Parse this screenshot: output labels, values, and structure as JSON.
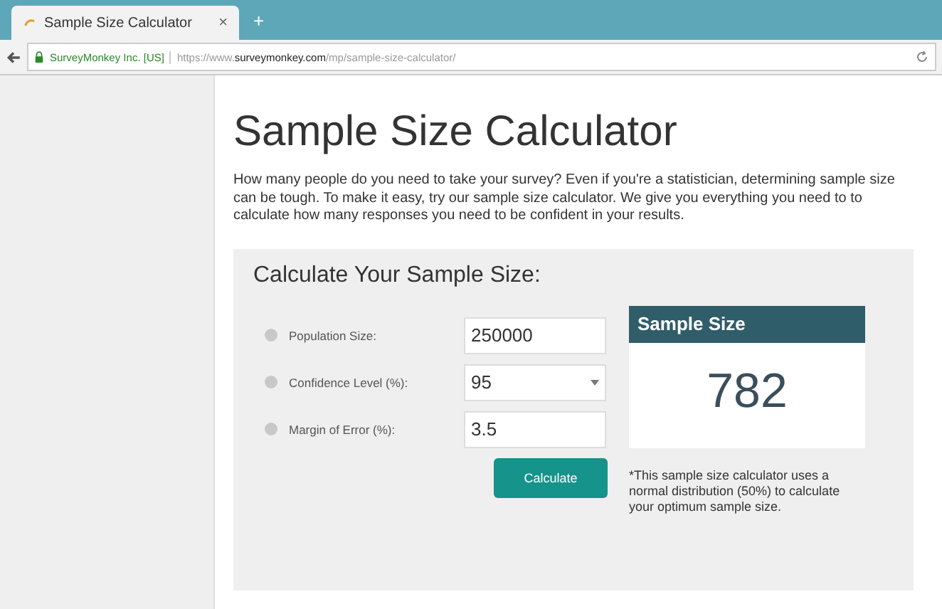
{
  "browser": {
    "tab": {
      "title": "Sample Size Calculator",
      "close": "×"
    },
    "new_tab": "+",
    "security": "SurveyMonkey Inc. [US]",
    "url_scheme": "https://www.",
    "url_domain": "surveymonkey.com",
    "url_path": "/mp/sample-size-calculator/"
  },
  "page": {
    "title": "Sample Size Calculator",
    "intro": "How many people do you need to take your survey? Even if you're a statistician, determining sample size can be tough. To make it easy, try our sample size calculator. We give you everything you need to to calculate how many responses you need to be confident in your results.",
    "calculator": {
      "heading": "Calculate Your Sample Size:",
      "fields": [
        {
          "kind": "input",
          "label": "Population Size:",
          "value": "250000"
        },
        {
          "kind": "select",
          "label": "Confidence Level (%):",
          "value": "95"
        },
        {
          "kind": "input",
          "label": "Margin of Error (%):",
          "value": "3.5"
        }
      ],
      "button": "Calculate",
      "result": {
        "title": "Sample Size",
        "value": "782"
      },
      "note": "*This sample size calculator uses a normal distribution (50%) to calculate your optimum sample size."
    }
  }
}
